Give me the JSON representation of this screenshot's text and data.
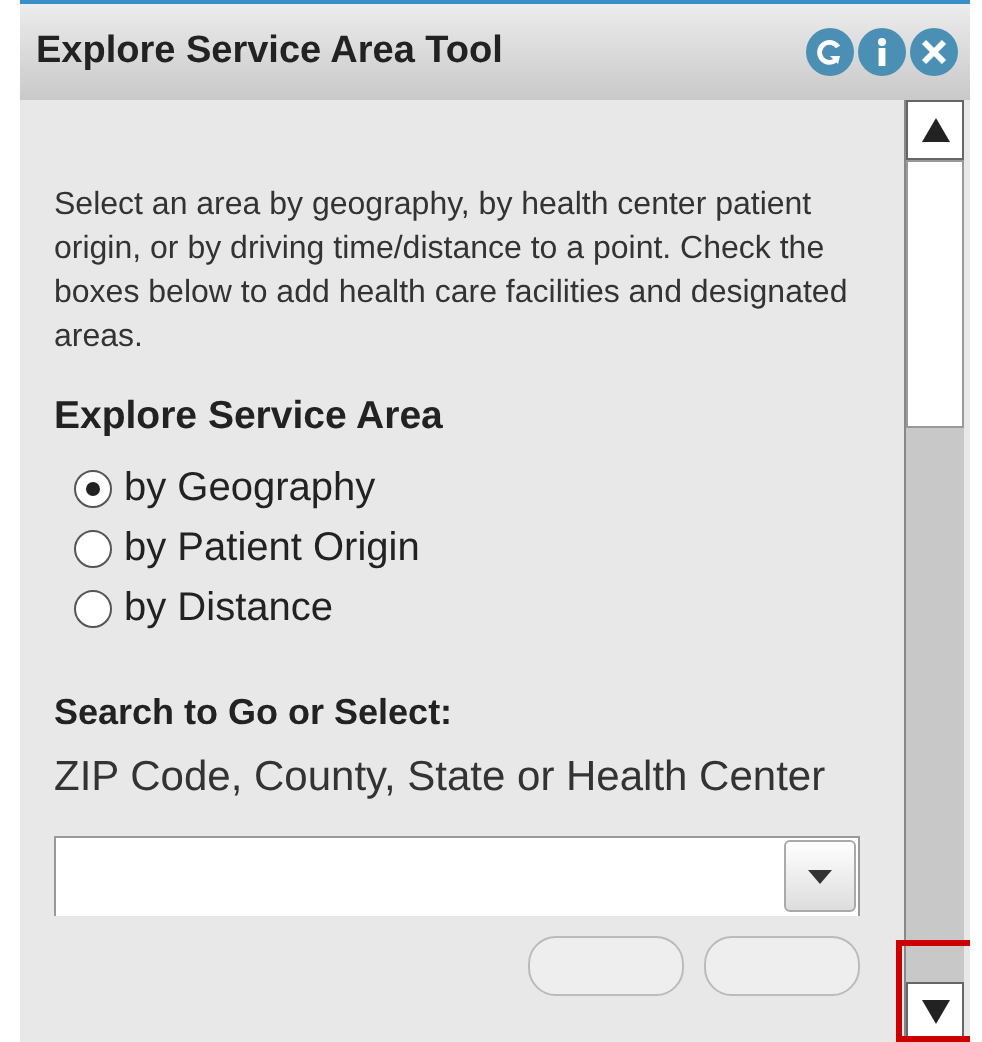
{
  "window": {
    "title": "Explore Service Area Tool"
  },
  "header_buttons": [
    {
      "kind": "refresh"
    },
    {
      "kind": "info"
    },
    {
      "kind": "close"
    }
  ],
  "description": "Select an area by geography, by health center patient origin, or by driving time/distance to a point. Check the boxes below to add health care facilities and designated areas.",
  "explore": {
    "heading": "Explore Service Area",
    "options": [
      {
        "label": "by Geography",
        "selected": true
      },
      {
        "label": "by Patient Origin",
        "selected": false
      },
      {
        "label": "by Distance",
        "selected": false
      }
    ]
  },
  "search": {
    "heading": "Search to Go or Select:",
    "hint": "ZIP Code, County, State or Health Center"
  }
}
